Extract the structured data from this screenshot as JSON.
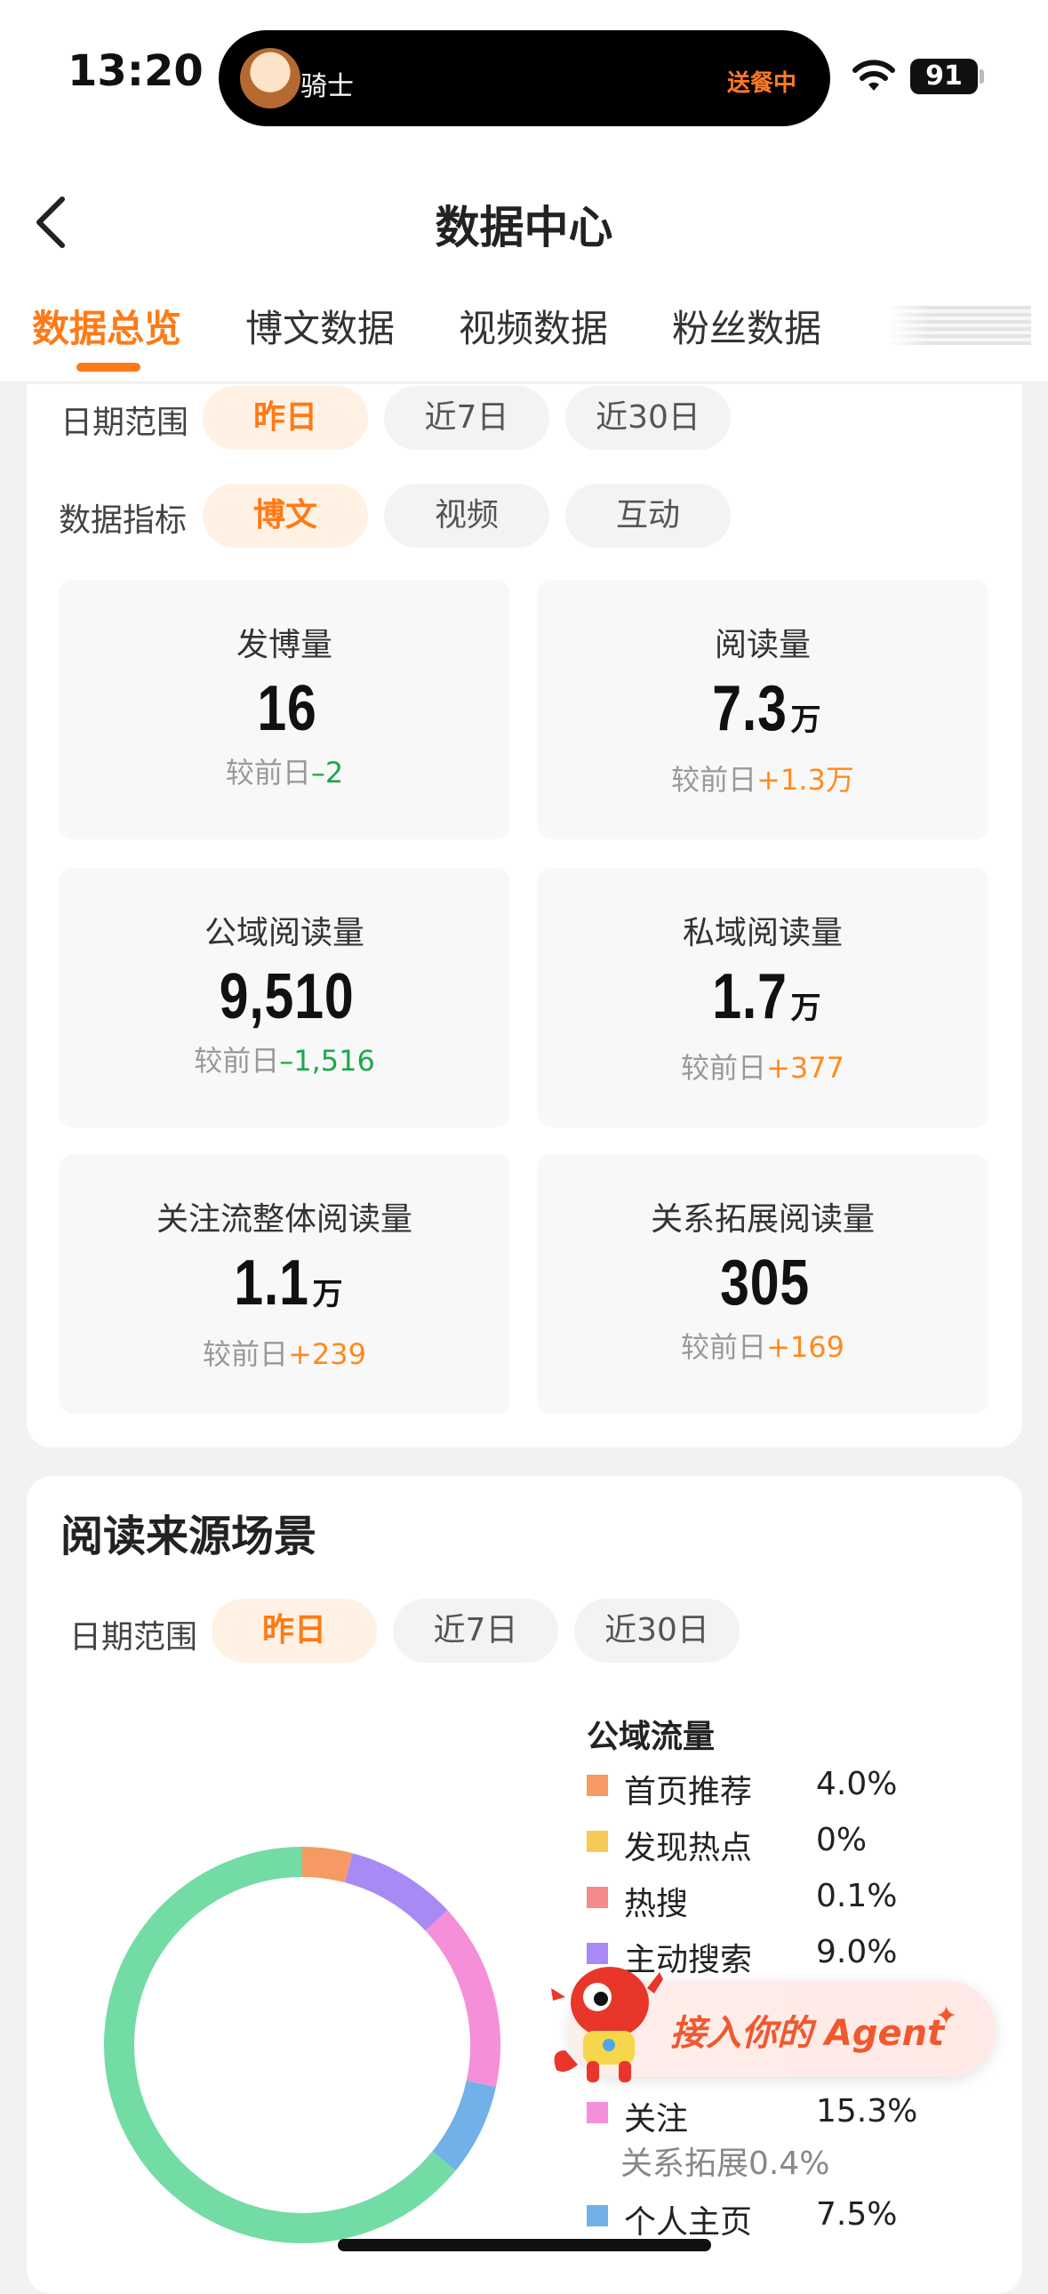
{
  "status_bar": {
    "time": "13:20",
    "activity_name": "骑士",
    "activity_status": "送餐中",
    "battery": "91"
  },
  "nav": {
    "title": "数据中心",
    "tabs": [
      {
        "label": "数据总览",
        "active": true
      },
      {
        "label": "博文数据",
        "active": false
      },
      {
        "label": "视频数据",
        "active": false
      },
      {
        "label": "粉丝数据",
        "active": false
      }
    ]
  },
  "overview": {
    "date_label": "日期范围",
    "date_chips": [
      "昨日",
      "近7日",
      "近30日"
    ],
    "metric_label": "数据指标",
    "metric_chips": [
      "博文",
      "视频",
      "互动"
    ],
    "compare_prefix": "较前日",
    "metrics": [
      {
        "label": "发博量",
        "value": "16",
        "unit": "",
        "delta": "–2",
        "trend": "neg"
      },
      {
        "label": "阅读量",
        "value": "7.3",
        "unit": "万",
        "delta": "+1.3万",
        "trend": "pos"
      },
      {
        "label": "公域阅读量",
        "value": "9,510",
        "unit": "",
        "delta": "–1,516",
        "trend": "neg"
      },
      {
        "label": "私域阅读量",
        "value": "1.7",
        "unit": "万",
        "delta": "+377",
        "trend": "pos"
      },
      {
        "label": "关注流整体阅读量",
        "value": "1.1",
        "unit": "万",
        "delta": "+239",
        "trend": "pos"
      },
      {
        "label": "关系拓展阅读量",
        "value": "305",
        "unit": "",
        "delta": "+169",
        "trend": "pos"
      }
    ]
  },
  "sources": {
    "title": "阅读来源场景",
    "date_label": "日期范围",
    "date_chips": [
      "昨日",
      "近7日",
      "近30日"
    ],
    "legend_title": "公域流量",
    "legend": [
      {
        "name": "首页推荐",
        "pct": "4.0%",
        "color": "#f59a62"
      },
      {
        "name": "发现热点",
        "pct": "0%",
        "color": "#f7c95a"
      },
      {
        "name": "热搜",
        "pct": "0.1%",
        "color": "#f58a8a"
      },
      {
        "name": "主动搜索",
        "pct": "9.0%",
        "color": "#a98af5"
      },
      {
        "name": "关注",
        "pct": "15.3%",
        "color": "#f68fd9"
      },
      {
        "name": "个人主页",
        "pct": "7.5%",
        "color": "#72b0ea"
      }
    ],
    "legend_sub": "关系拓展0.4%",
    "donut_other_color": "#73dca5"
  },
  "agent": {
    "label": "接入你的 Agent",
    "spark": "✦"
  }
}
